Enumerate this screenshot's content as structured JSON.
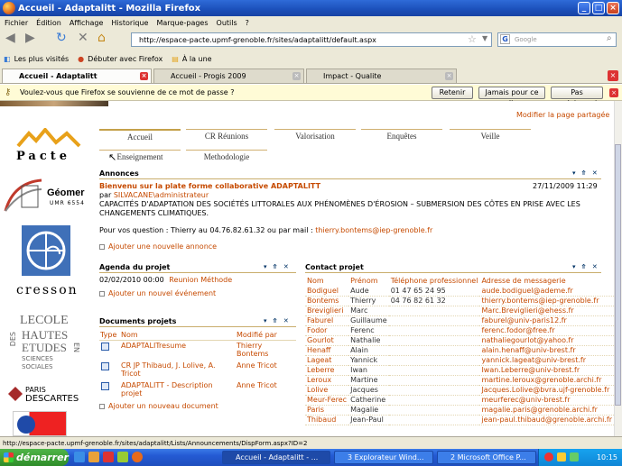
{
  "window": {
    "title": "Accueil - Adaptalitt - Mozilla Firefox"
  },
  "menu": [
    "Fichier",
    "Édition",
    "Affichage",
    "Historique",
    "Marque-pages",
    "Outils",
    "?"
  ],
  "nav": {
    "url": "http://espace-pacte.upmf-grenoble.fr/sites/adaptalitt/default.aspx",
    "search_placeholder": "Google"
  },
  "bookmarks": [
    "Les plus visités",
    "Débuter avec Firefox",
    "À la une"
  ],
  "tabs": [
    {
      "label": "Accueil - Adaptalitt"
    },
    {
      "label": "Accueil - Progis 2009"
    },
    {
      "label": "Impact - Qualite"
    }
  ],
  "notification": {
    "text": "Voulez-vous que Firefox se souvienne de ce mot de passe ?",
    "buttons": [
      "Retenir",
      "Jamais pour ce site",
      "Pas maintenant"
    ]
  },
  "page": {
    "modify_link": "Modifier la page partagée",
    "logos": [
      "Pacte",
      "Géomer",
      "UMR 6554",
      "cresson",
      "LECOLE",
      "DES",
      "HAUTES",
      "ETUDES",
      "EN",
      "SCIENCES",
      "SOCIALES",
      "PARIS",
      "DESCARTES"
    ],
    "nav_tabs": [
      "Accueil",
      "CR Réunions",
      "Valorisation",
      "Enquêtes",
      "Veille",
      "Enseignement",
      "Methodologie"
    ],
    "annonces": {
      "title": "Annonces",
      "item_title": "Bienvenu sur la plate forme collaborative ADAPTALITT",
      "date": "27/11/2009 11:29",
      "by_prefix": "par ",
      "author": "SILVACANE\\administrateur",
      "body": "CAPACITÉS D'ADAPTATION DES SOCIÉTÉS LITTORALES AUX PHÉNOMÈNES D'ÉROSION – SUBMERSION DES CÔTES EN PRISE AVEC LES CHANGEMENTS CLIMATIQUES.",
      "contact_prefix": "Pour vos question : Thierry au 04.76.82.61.32 ou par mail : ",
      "contact_email": "thierry.bontems@iep-grenoble.fr",
      "add": "Ajouter une nouvelle annonce"
    },
    "agenda": {
      "title": "Agenda du projet",
      "date": "02/02/2010 00:00",
      "event": "Reunion Méthode",
      "add": "Ajouter un nouvel événement"
    },
    "documents": {
      "title": "Documents projets",
      "headers": [
        "Type",
        "Nom",
        "Modifié par"
      ],
      "rows": [
        {
          "name": "ADAPTALITresume",
          "by": "Thierry Bontems"
        },
        {
          "name": "CR JP Thibaud, J. Lolive, A. Tricot",
          "by": "Anne Tricot"
        },
        {
          "name": "ADAPTALITT - Description projet",
          "by": "Anne Tricot"
        }
      ],
      "add": "Ajouter un nouveau document"
    },
    "contacts": {
      "title": "Contact projet",
      "headers": [
        "Nom",
        "Prénom",
        "Téléphone professionnel",
        "Adresse de messagerie"
      ],
      "rows": [
        [
          "Bodiguel",
          "Aude",
          "01 47 65 24 95",
          "aude.bodiguel@ademe.fr"
        ],
        [
          "Bontems",
          "Thierry",
          "04 76 82 61 32",
          "thierry.bontems@iep-grenoble.fr"
        ],
        [
          "Breviglieri",
          "Marc",
          "",
          "Marc.Breviglieri@ehess.fr"
        ],
        [
          "Faburel",
          "Guillaume",
          "",
          "faburel@univ-paris12.fr"
        ],
        [
          "Fodor",
          "Ferenc",
          "",
          "ferenc.fodor@free.fr"
        ],
        [
          "Gourlot",
          "Nathalie",
          "",
          "nathaliegourlot@yahoo.fr"
        ],
        [
          "Henaff",
          "Alain",
          "",
          "alain.henaff@univ-brest.fr"
        ],
        [
          "Lageat",
          "Yannick",
          "",
          "yannick.lageat@univ-brest.fr"
        ],
        [
          "Leberre",
          "Iwan",
          "",
          "Iwan.Leberre@univ-brest.fr"
        ],
        [
          "Leroux",
          "Martine",
          "",
          "martine.leroux@grenoble.archi.fr"
        ],
        [
          "Lolive",
          "Jacques",
          "",
          "Jacques.Lolive@bvra.ujf-grenoble.fr"
        ],
        [
          "Meur-Ferec",
          "Catherine",
          "",
          "meurferec@univ-brest.fr"
        ],
        [
          "Paris",
          "Magalie",
          "",
          "magalie.paris@grenoble.archi.fr"
        ],
        [
          "Thibaud",
          "Jean-Paul",
          "",
          "jean-paul.thibaud@grenoble.archi.fr"
        ]
      ]
    }
  },
  "status": "http://espace-pacte.upmf-grenoble.fr/sites/adaptalitt/Lists/Announcements/DispForm.aspx?ID=2",
  "taskbar": {
    "start": "démarrer",
    "tasks": [
      "Accueil - Adaptalitt - ...",
      "3 Explorateur Wind...",
      "2 Microsoft Office P..."
    ],
    "clock": "10:15"
  },
  "colors": {
    "accent": "#c64a00",
    "tab_border": "#c4a14a",
    "title_blue": "#1b4fb9"
  }
}
